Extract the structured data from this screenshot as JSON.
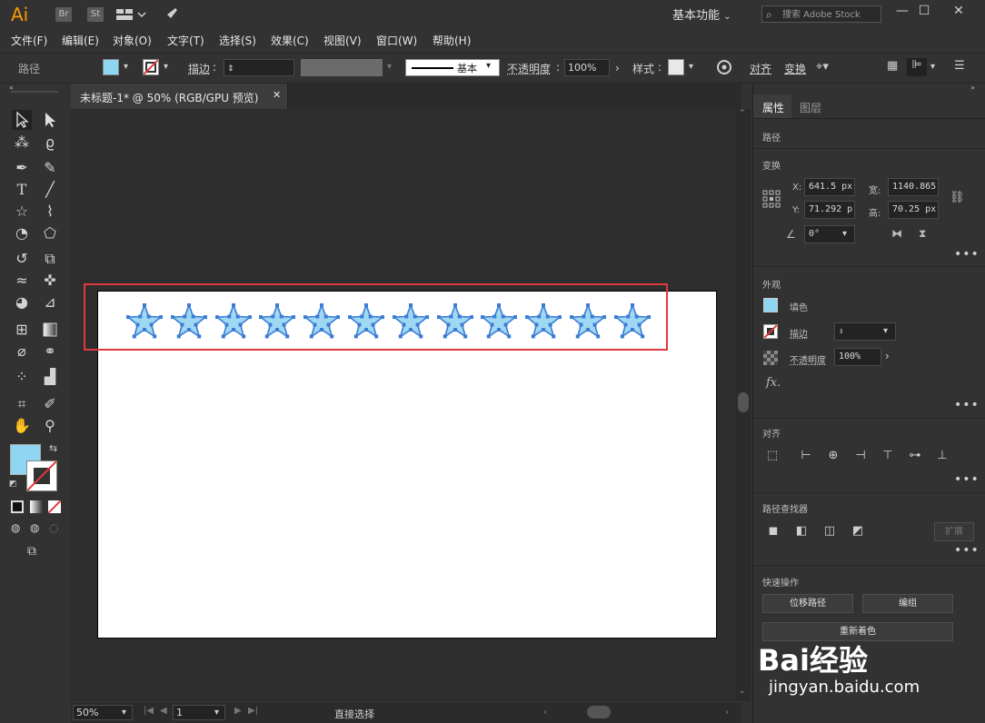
{
  "app": {
    "logo": "Ai",
    "bridge": "Br",
    "stock": "St",
    "workspace": "基本功能",
    "search_placeholder": "搜索 Adobe Stock"
  },
  "window_controls": {
    "minimize": "—",
    "maximize": "☐",
    "close": "✕"
  },
  "menu": [
    "文件(F)",
    "编辑(E)",
    "对象(O)",
    "文字(T)",
    "选择(S)",
    "效果(C)",
    "视图(V)",
    "窗口(W)",
    "帮助(H)"
  ],
  "control_bar": {
    "selection_type": "路径",
    "stroke_label": "描边",
    "stroke_style": "基本",
    "opacity_label": "不透明度",
    "opacity_value": "100%",
    "style_label": "样式",
    "align_label": "对齐",
    "transform_label": "变换"
  },
  "document_tab": {
    "title": "未标题-1* @ 50% (RGB/GPU 预览)",
    "close": "✕"
  },
  "colors": {
    "fill": "#8fd6f2",
    "star_fill": "#9fd8f2",
    "star_stroke": "#3a7bd5",
    "highlight": "#e0393e"
  },
  "artwork": {
    "star_count": 12
  },
  "status": {
    "zoom": "50%",
    "page": "1",
    "tool": "直接选择"
  },
  "panel": {
    "tabs": [
      "属性",
      "图层"
    ],
    "selection": "路径",
    "transform": {
      "title": "变换",
      "x_label": "X:",
      "x_value": "641.5 px",
      "y_label": "Y:",
      "y_value": "71.292 p",
      "w_label": "宽:",
      "w_value": "1140.865",
      "h_label": "高:",
      "h_value": "70.25 px",
      "angle_value": "0°"
    },
    "appearance": {
      "title": "外观",
      "fill_label": "填色",
      "stroke_label": "描边",
      "opacity_label": "不透明度",
      "opacity_value": "100%",
      "fx": "fx."
    },
    "align": {
      "title": "对齐"
    },
    "pathfinder": {
      "title": "路径查找器",
      "expand": "扩展"
    },
    "quick_actions": {
      "title": "快速操作",
      "offset_path": "位移路径",
      "edit": "编组",
      "recolor": "重新着色"
    }
  },
  "watermark": {
    "brand": "Bai经验",
    "url": "jingyan.baidu.com"
  }
}
